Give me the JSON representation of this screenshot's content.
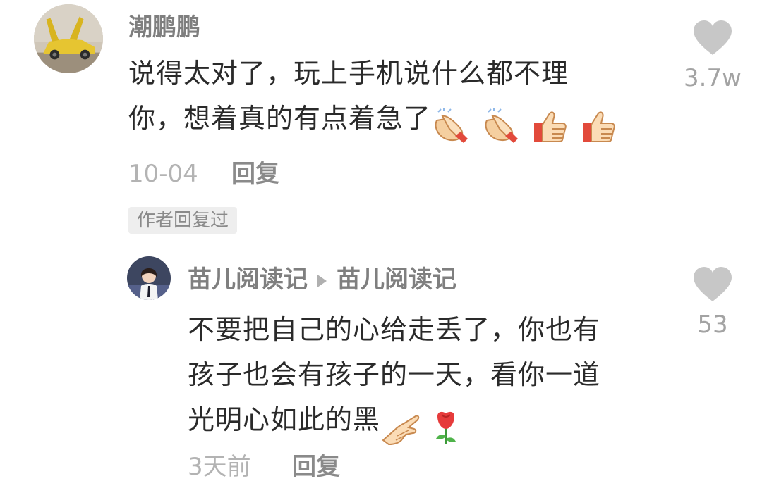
{
  "comments": [
    {
      "username": "潮鹏鹏",
      "line1": "说得太对了，玩上手机说什么都不理",
      "line2": "你，想着真的有点着急了",
      "date": "10-04",
      "reply_label": "回复",
      "likes": "3.7w",
      "author_badge": "作者回复过",
      "emojis": [
        "clapping-hands-icon",
        "clapping-hands-icon",
        "thumbs-up-icon",
        "thumbs-up-icon"
      ]
    }
  ],
  "replies": [
    {
      "username": "苗儿阅读记",
      "reply_to": "苗儿阅读记",
      "line1": "不要把自己的心给走丢了，你也有",
      "line2": "孩子也会有孩子的一天，看你一道",
      "line3": "光明心如此的黑",
      "date": "3天前",
      "reply_label": "回复",
      "likes": "53",
      "emojis": [
        "pointing-hand-icon",
        "rose-icon"
      ]
    }
  ],
  "colors": {
    "username": "#7f7f7f",
    "text": "#2a2a2a",
    "meta": "#b3b3b3",
    "heart": "#c7c7c7",
    "badge_bg": "#eeeeee"
  }
}
